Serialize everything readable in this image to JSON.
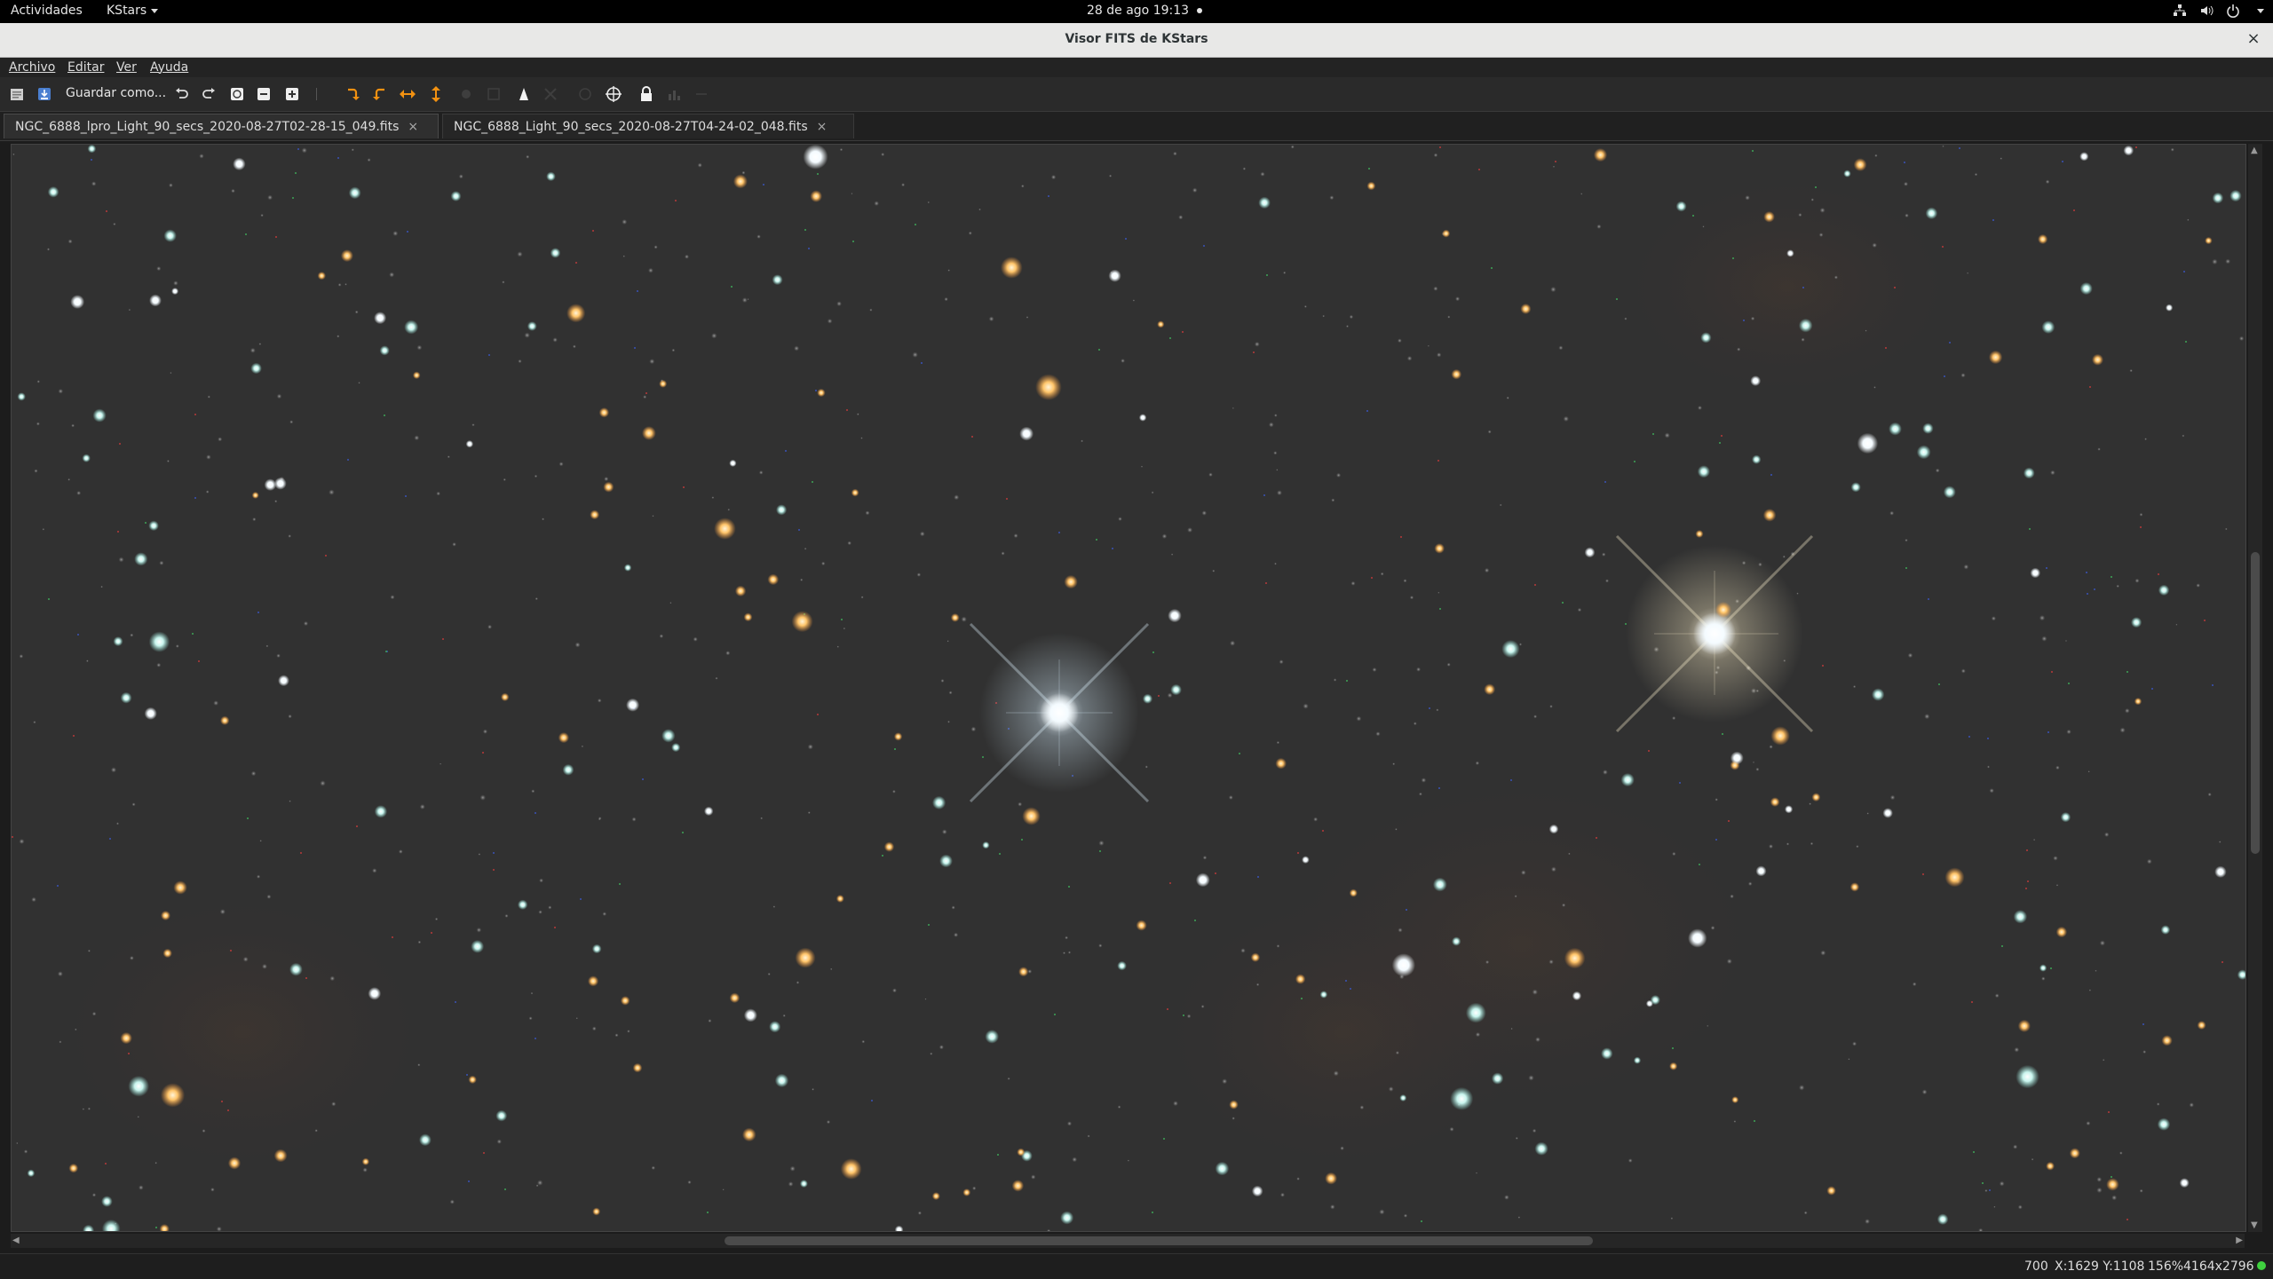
{
  "system_bar": {
    "activities": "Actividades",
    "app_menu": "KStars",
    "clock": "28 de ago  19:13"
  },
  "window": {
    "title": "Visor FITS de KStars",
    "close_glyph": "×"
  },
  "menubar": {
    "items": [
      "Archivo",
      "Editar",
      "Ver",
      "Ayuda"
    ]
  },
  "toolbar": {
    "save_as_label": "Guardar como...",
    "icons": [
      "open-file-icon",
      "save-icon",
      "undo-icon",
      "redo-icon",
      "fit-icon",
      "zoom-out-icon",
      "zoom-in-icon",
      "rotate-cw-icon",
      "rotate-ccw-icon",
      "flip-horizontal-icon",
      "flip-vertical-icon",
      "star-detect-icon",
      "crosshair-icon",
      "lock-icon",
      "histogram-icon"
    ]
  },
  "tabs": [
    {
      "label": "NGC_6888_lpro_Light_90_secs_2020-08-27T02-28-15_049.fits",
      "close": "×",
      "active": true
    },
    {
      "label": "NGC_6888_Light_90_secs_2020-08-27T04-24-02_048.fits",
      "close": "×",
      "active": false
    }
  ],
  "status": {
    "value": "700",
    "coords": "X:1629 Y:1108",
    "zoom": "156%",
    "size": "4164x2796"
  },
  "colors": {
    "sky_background": "#313131",
    "status_led": "#3fd13f",
    "accent_orange": "#f29111"
  }
}
